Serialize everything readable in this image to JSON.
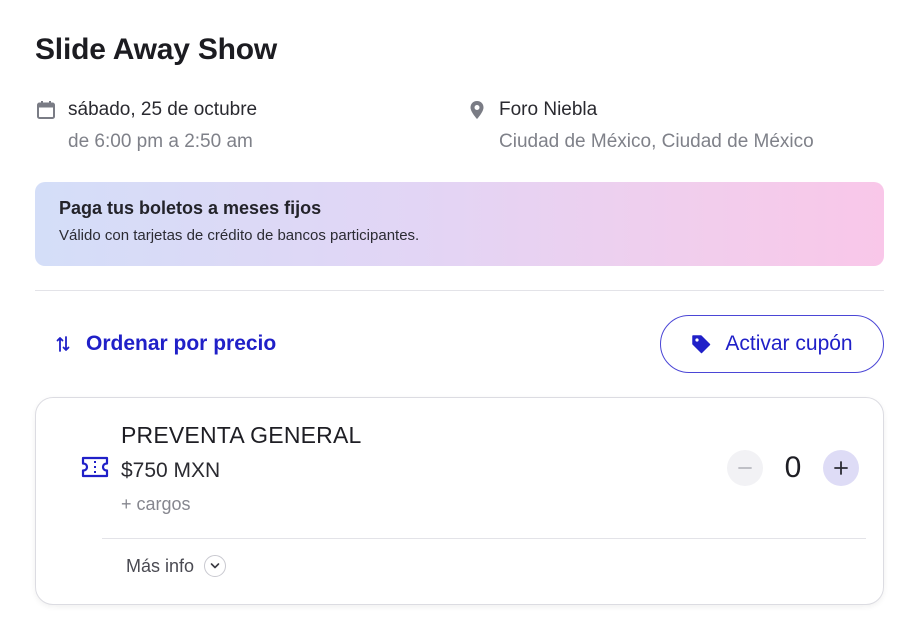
{
  "event": {
    "title": "Slide Away Show"
  },
  "schedule": {
    "date": "sábado, 25 de octubre",
    "time": "de 6:00 pm a 2:50 am",
    "icon": "calendar-icon"
  },
  "venue": {
    "name": "Foro Niebla",
    "city": "Ciudad de México, Ciudad de México",
    "icon": "location-pin-icon"
  },
  "banner": {
    "title": "Paga tus boletos a meses fijos",
    "subtitle": "Válido con tarjetas de crédito de bancos participantes."
  },
  "toolbar": {
    "sort_label": "Ordenar por precio",
    "sort_icon": "sort-arrows-icon",
    "coupon_label": "Activar cupón",
    "coupon_icon": "tag-icon"
  },
  "tickets": [
    {
      "name": "PREVENTA GENERAL",
      "price": "$750 MXN",
      "charges": "+ cargos",
      "quantity": "0",
      "more_info_label": "Más info",
      "icon": "ticket-icon"
    }
  ],
  "colors": {
    "accent": "#2020c8",
    "banner_start": "#d4def8",
    "banner_end": "#f9c7e9",
    "plus_bg": "#dedcf6"
  }
}
